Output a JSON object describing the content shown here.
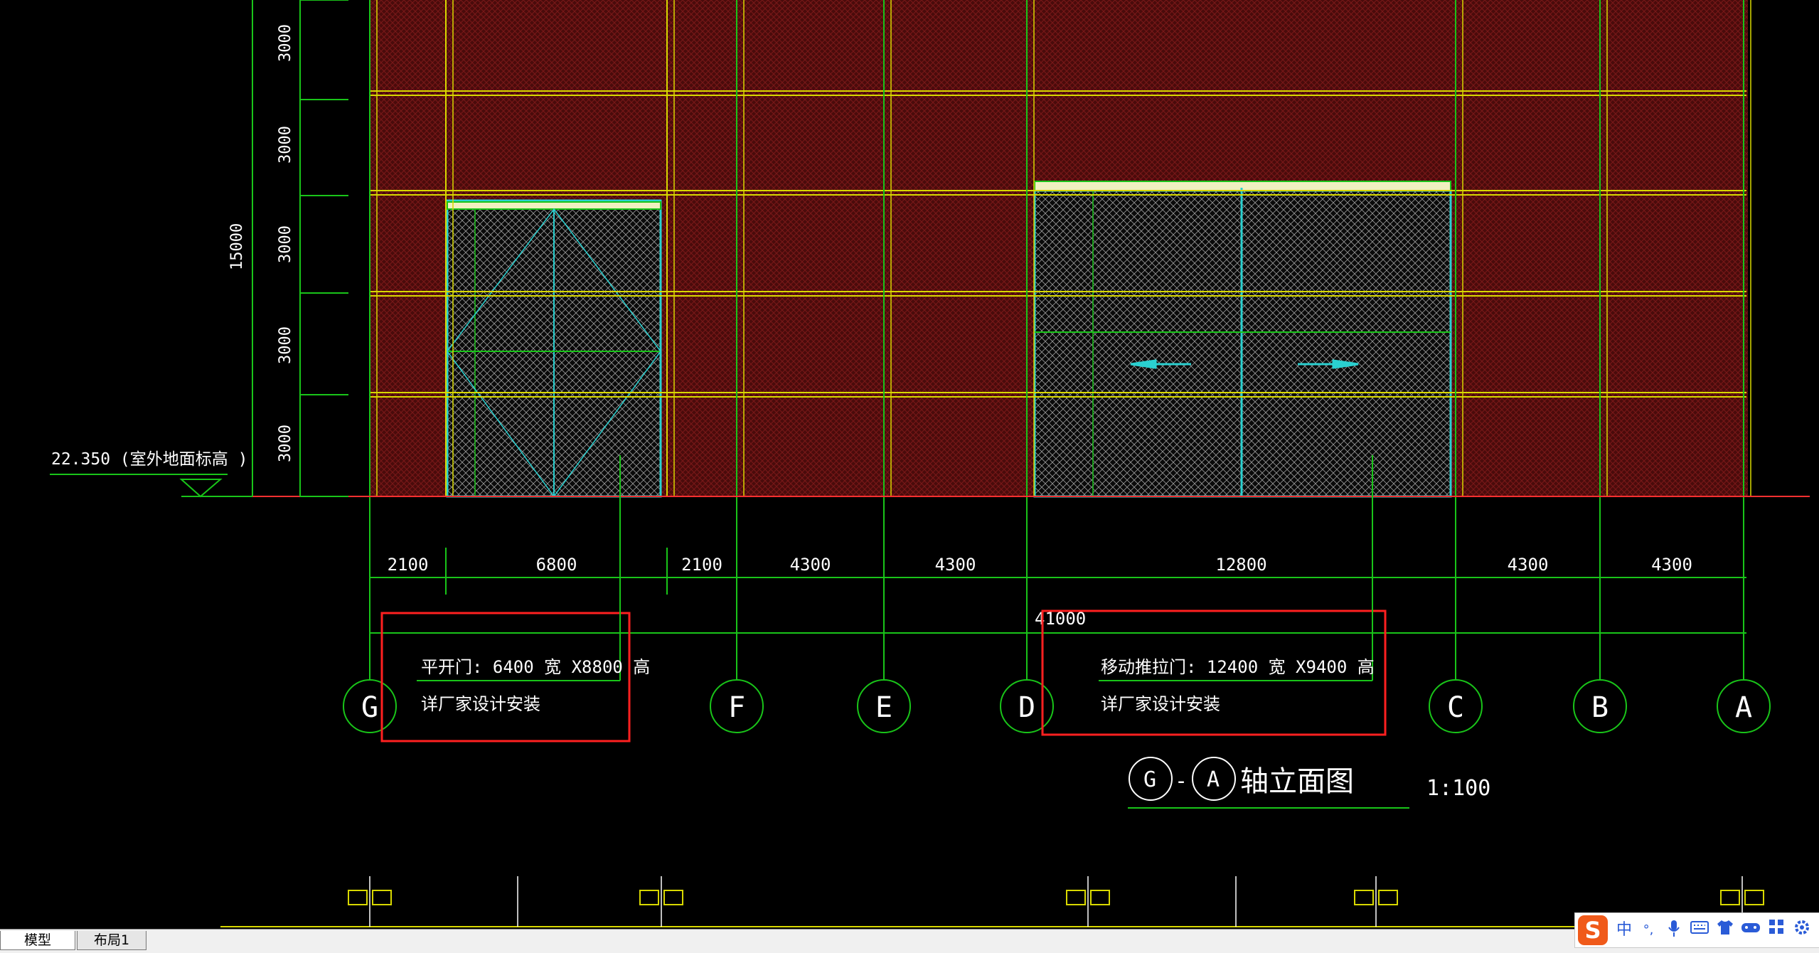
{
  "drawing": {
    "title_prefix_axis_1": "G",
    "title_separator": "-",
    "title_prefix_axis_2": "A",
    "title_text": "轴立面图",
    "scale": "1:100",
    "ground_elevation_label": "22.350  (室外地面标高      )",
    "total_height": "15000",
    "row_heights": [
      "3000",
      "3000",
      "3000",
      "3000",
      "3000"
    ],
    "bay_dimensions": [
      "2100",
      "6800",
      "2100",
      "4300",
      "4300",
      "12800",
      "4300",
      "4300"
    ],
    "total_width": "41000",
    "axes": [
      "G",
      "F",
      "E",
      "D",
      "C",
      "B",
      "A"
    ],
    "door_annotations": [
      {
        "line1": "平开门:     6400 宽 X8800 高",
        "line2": "详厂家设计安装"
      },
      {
        "line1": "移动推拉门:     12400 宽 X9400 高",
        "line2": "详厂家设计安装"
      }
    ],
    "small_door_dims": [
      "6400",
      "8800"
    ],
    "large_door_dims": [
      "12400",
      "9400"
    ]
  },
  "layout_tabs": [
    {
      "label": "模型",
      "active": true
    },
    {
      "label": "布局1",
      "active": false
    }
  ],
  "ime_toolbar": {
    "logo": "S",
    "items": [
      "中",
      "°,",
      "mic-icon",
      "keyboard-icon",
      "shirt-icon",
      "game-icon",
      "grid-icon",
      "settings-icon"
    ]
  },
  "colors": {
    "background": "#000000",
    "panel_fill": "#5a0d0d",
    "grid_yellow": "#d8d800",
    "axis_green": "#19c419",
    "door_cyan": "#2ad0d0",
    "annotation_red": "#ff2020"
  }
}
